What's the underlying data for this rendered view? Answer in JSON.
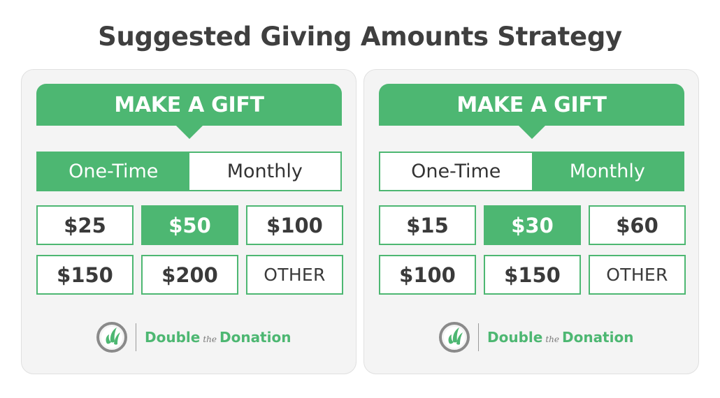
{
  "title": "Suggested Giving Amounts Strategy",
  "colors": {
    "accent": "#4db772",
    "text": "#3f3f3f",
    "card_bg": "#f4f4f4"
  },
  "cards": [
    {
      "banner": "MAKE A GIFT",
      "frequency": {
        "options": [
          "One-Time",
          "Monthly"
        ],
        "selected": "One-Time"
      },
      "amounts": [
        "$25",
        "$50",
        "$100",
        "$150",
        "$200",
        "OTHER"
      ],
      "selected_amount": "$50",
      "logo": {
        "icon": "double-the-donation-logo-icon",
        "text_before": "Double",
        "text_the": "the",
        "text_after": "Donation"
      }
    },
    {
      "banner": "MAKE A GIFT",
      "frequency": {
        "options": [
          "One-Time",
          "Monthly"
        ],
        "selected": "Monthly"
      },
      "amounts": [
        "$15",
        "$30",
        "$60",
        "$100",
        "$150",
        "OTHER"
      ],
      "selected_amount": "$30",
      "logo": {
        "icon": "double-the-donation-logo-icon",
        "text_before": "Double",
        "text_the": "the",
        "text_after": "Donation"
      }
    }
  ]
}
